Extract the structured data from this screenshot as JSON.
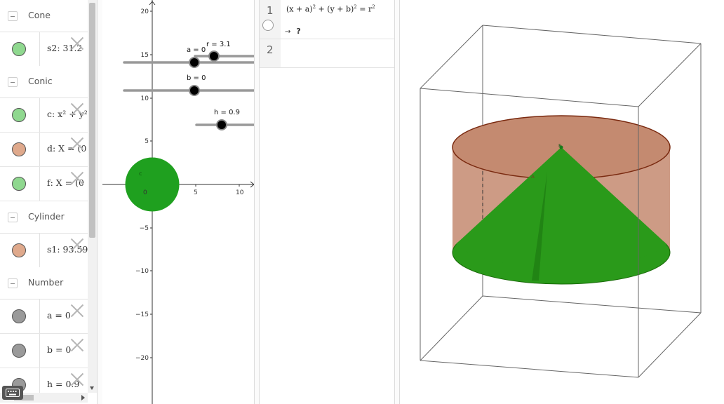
{
  "algebra": {
    "headers": {
      "cone": "Cone",
      "conic": "Conic",
      "cylinder": "Cylinder",
      "number": "Number"
    },
    "items": {
      "s2": {
        "text": "s2: 31.2",
        "color": "#8fd88f"
      },
      "c": {
        "text": "c: x² + y²",
        "color": "#8fd88f"
      },
      "d": {
        "text": "d: X = (0",
        "color": "#dfa98c"
      },
      "f": {
        "text": "f: X = (0",
        "color": "#8fd88f"
      },
      "s1": {
        "text": "s1: 93.59",
        "color": "#dfa98c"
      },
      "a": {
        "text": "a = 0",
        "color": "#9a9a9a"
      },
      "b": {
        "text": "b = 0",
        "color": "#9a9a9a"
      },
      "h": {
        "text": "h = 0.9",
        "color": "#9a9a9a"
      }
    }
  },
  "graphics": {
    "y_ticks": [
      "20",
      "15",
      "10",
      "5",
      "−5",
      "−10",
      "−15",
      "−20"
    ],
    "x_ticks": [
      "0",
      "5",
      "10"
    ],
    "sliders": {
      "r": "r = 3.1",
      "a": "a = 0",
      "b": "b = 0",
      "h": "h = 0.9"
    },
    "circle_label": "c",
    "circle_color": "#1fa01f"
  },
  "cas": {
    "row1_number": "1",
    "row1_lhs_a": "(x + a)",
    "row1_lhs_b": " + (y + b)",
    "row1_rhs": " = r",
    "exponent": "2",
    "row1_arrow": "→",
    "row1_result": "?",
    "row2_number": "2"
  },
  "view3d": {
    "cylinder_color": "#c48a70",
    "cone_color": "#2a9a1a",
    "apex_label": "F",
    "point_label": "A"
  }
}
